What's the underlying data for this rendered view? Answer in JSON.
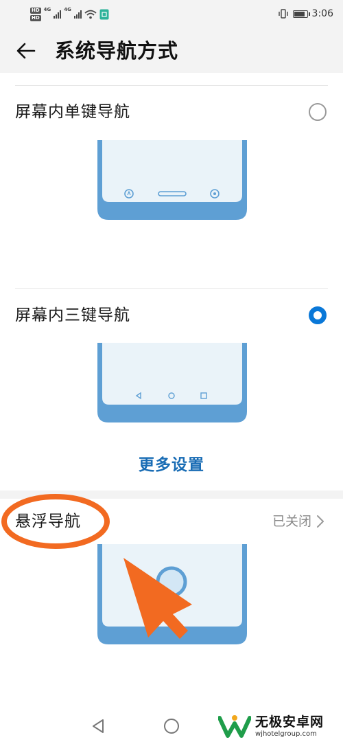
{
  "status_bar": {
    "hd_labels": [
      "HD",
      "HD"
    ],
    "network": [
      "4G",
      "4G"
    ],
    "time": "3:06",
    "battery_level": 0.85
  },
  "header": {
    "title": "系统导航方式"
  },
  "options": [
    {
      "label": "屏幕内单键导航",
      "selected": false
    },
    {
      "label": "屏幕内三键导航",
      "selected": true
    }
  ],
  "more_settings_label": "更多设置",
  "floating_nav": {
    "label": "悬浮导航",
    "status": "已关闭"
  },
  "watermark": {
    "title": "无极安卓网",
    "url": "wjhotelgroup.com"
  },
  "colors": {
    "accent": "#0a78d8",
    "link": "#1a6db5",
    "phone_frame": "#5e9fd4",
    "phone_screen": "#eaf3f9",
    "annotation": "#f26a21"
  }
}
